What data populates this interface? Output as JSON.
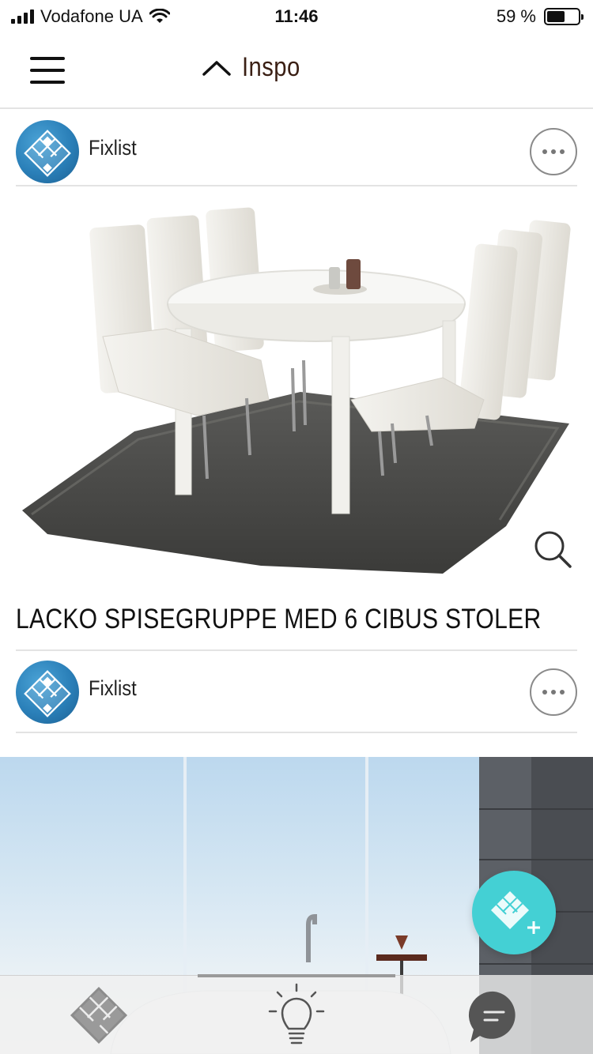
{
  "status_bar": {
    "carrier": "Vodafone UA",
    "time": "11:46",
    "battery_percent": "59 %",
    "battery_level": 0.59
  },
  "nav": {
    "title": "Inspo",
    "menu_icon": "hamburger-menu-icon",
    "collapse_icon": "chevron-up-icon"
  },
  "posts": [
    {
      "author": "Fixlist",
      "avatar_icon": "fixlist-logo-icon",
      "image_alt": "white dining table with six chairs on dark shag rug",
      "title": "LACKO SPISEGRUPPE MED 6 CIBUS STOLER"
    },
    {
      "author": "Fixlist",
      "avatar_icon": "fixlist-logo-icon",
      "image_alt": "bright bathroom with window wall and freestanding bathtub"
    }
  ],
  "fab": {
    "icon": "add-fixlist-icon"
  },
  "tab_bar": {
    "items": [
      {
        "icon": "fixlist-home-icon"
      },
      {
        "icon": "lightbulb-icon",
        "active": true
      },
      {
        "icon": "chat-bubble-icon"
      }
    ]
  },
  "colors": {
    "accent": "#44d0d4",
    "nav_title": "#3a1f14",
    "avatar": "#2a7fb8",
    "divider": "#e3e3e3"
  }
}
